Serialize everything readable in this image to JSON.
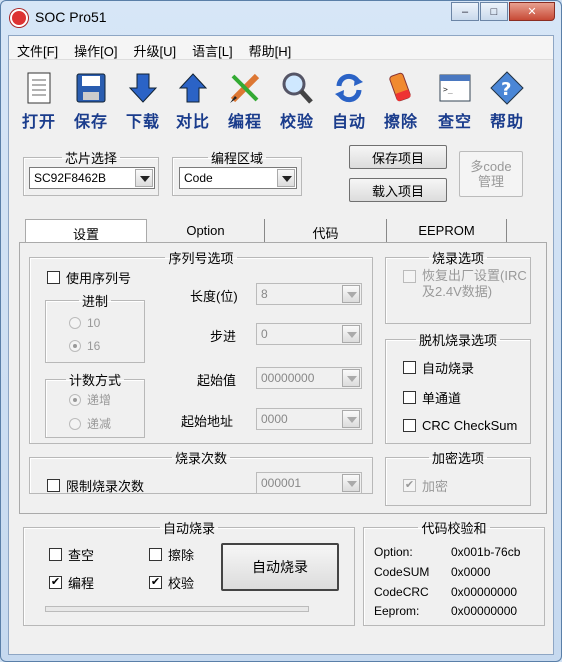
{
  "window": {
    "title": "SOC Pro51",
    "buttons": {
      "minimize": "–",
      "maximize": "□",
      "close": "✕"
    }
  },
  "menu": [
    "文件[F]",
    "操作[O]",
    "升级[U]",
    "语言[L]",
    "帮助[H]"
  ],
  "toolbar": [
    {
      "label": "打开",
      "icon": "open-file-icon"
    },
    {
      "label": "保存",
      "icon": "save-disk-icon"
    },
    {
      "label": "下载",
      "icon": "download-arrow-icon"
    },
    {
      "label": "对比",
      "icon": "compare-arrow-icon"
    },
    {
      "label": "编程",
      "icon": "program-pencil-icon"
    },
    {
      "label": "校验",
      "icon": "verify-magnifier-icon"
    },
    {
      "label": "自动",
      "icon": "auto-refresh-icon"
    },
    {
      "label": "擦除",
      "icon": "eraser-icon"
    },
    {
      "label": "查空",
      "icon": "blank-check-icon"
    },
    {
      "label": "帮助",
      "icon": "help-icon"
    }
  ],
  "chip": {
    "legend": "芯片选择",
    "value": "SC92F8462B"
  },
  "region": {
    "legend": "编程区域",
    "value": "Code"
  },
  "project": {
    "save": "保存项目",
    "load": "载入项目",
    "multi_line1": "多code",
    "multi_line2": "管理"
  },
  "tabs": [
    "设置",
    "Option",
    "代码",
    "EEPROM"
  ],
  "serial": {
    "legend": "序列号选项",
    "use": "使用序列号",
    "radix_legend": "进制",
    "radix": [
      "10",
      "16"
    ],
    "count_legend": "计数方式",
    "count": [
      "递增",
      "递减"
    ],
    "fields": [
      {
        "label": "长度(位)",
        "value": "8"
      },
      {
        "label": "步进",
        "value": "0"
      },
      {
        "label": "起始值",
        "value": "00000000"
      },
      {
        "label": "起始地址",
        "value": "0000"
      }
    ]
  },
  "burn_count": {
    "legend": "烧录次数",
    "limit": "限制烧录次数",
    "value": "000001"
  },
  "burn_opts": {
    "legend": "烧录选项",
    "restore": "恢复出厂设置(IRC及2.4V数据)"
  },
  "offline": {
    "legend": "脱机烧录选项",
    "items": [
      "自动烧录",
      "单通道",
      "CRC CheckSum"
    ]
  },
  "encrypt": {
    "legend": "加密选项",
    "item": "加密",
    "checked": true
  },
  "auto": {
    "legend": "自动烧录",
    "items": [
      {
        "label": "查空",
        "checked": false
      },
      {
        "label": "擦除",
        "checked": false
      },
      {
        "label": "编程",
        "checked": true
      },
      {
        "label": "校验",
        "checked": true
      }
    ],
    "button": "自动烧录",
    "progress": 0
  },
  "checksum": {
    "legend": "代码校验和",
    "rows": [
      {
        "k": "Option:",
        "v": "0x001b-76cb"
      },
      {
        "k": "CodeSUM",
        "v": "0x0000"
      },
      {
        "k": "CodeCRC",
        "v": "0x00000000"
      },
      {
        "k": "Eeprom:",
        "v": "0x00000000"
      }
    ]
  }
}
